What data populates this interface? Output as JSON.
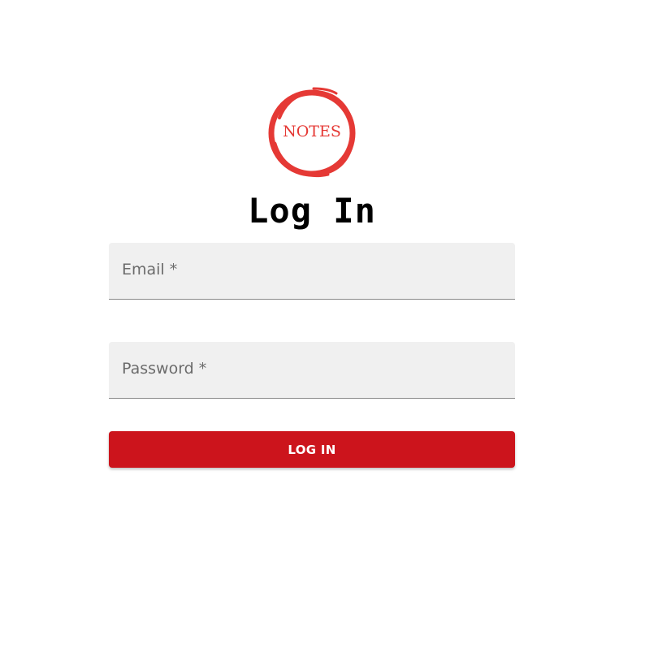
{
  "logo": {
    "text": "NOTES",
    "color": "#e53935"
  },
  "title": "Log In",
  "form": {
    "email": {
      "label": "Email *",
      "value": ""
    },
    "password": {
      "label": "Password *",
      "value": ""
    },
    "submit_label": "LOG IN"
  },
  "colors": {
    "button": "#cc141c",
    "field_background": "#f0f0f0",
    "label": "#6b6b6b"
  }
}
